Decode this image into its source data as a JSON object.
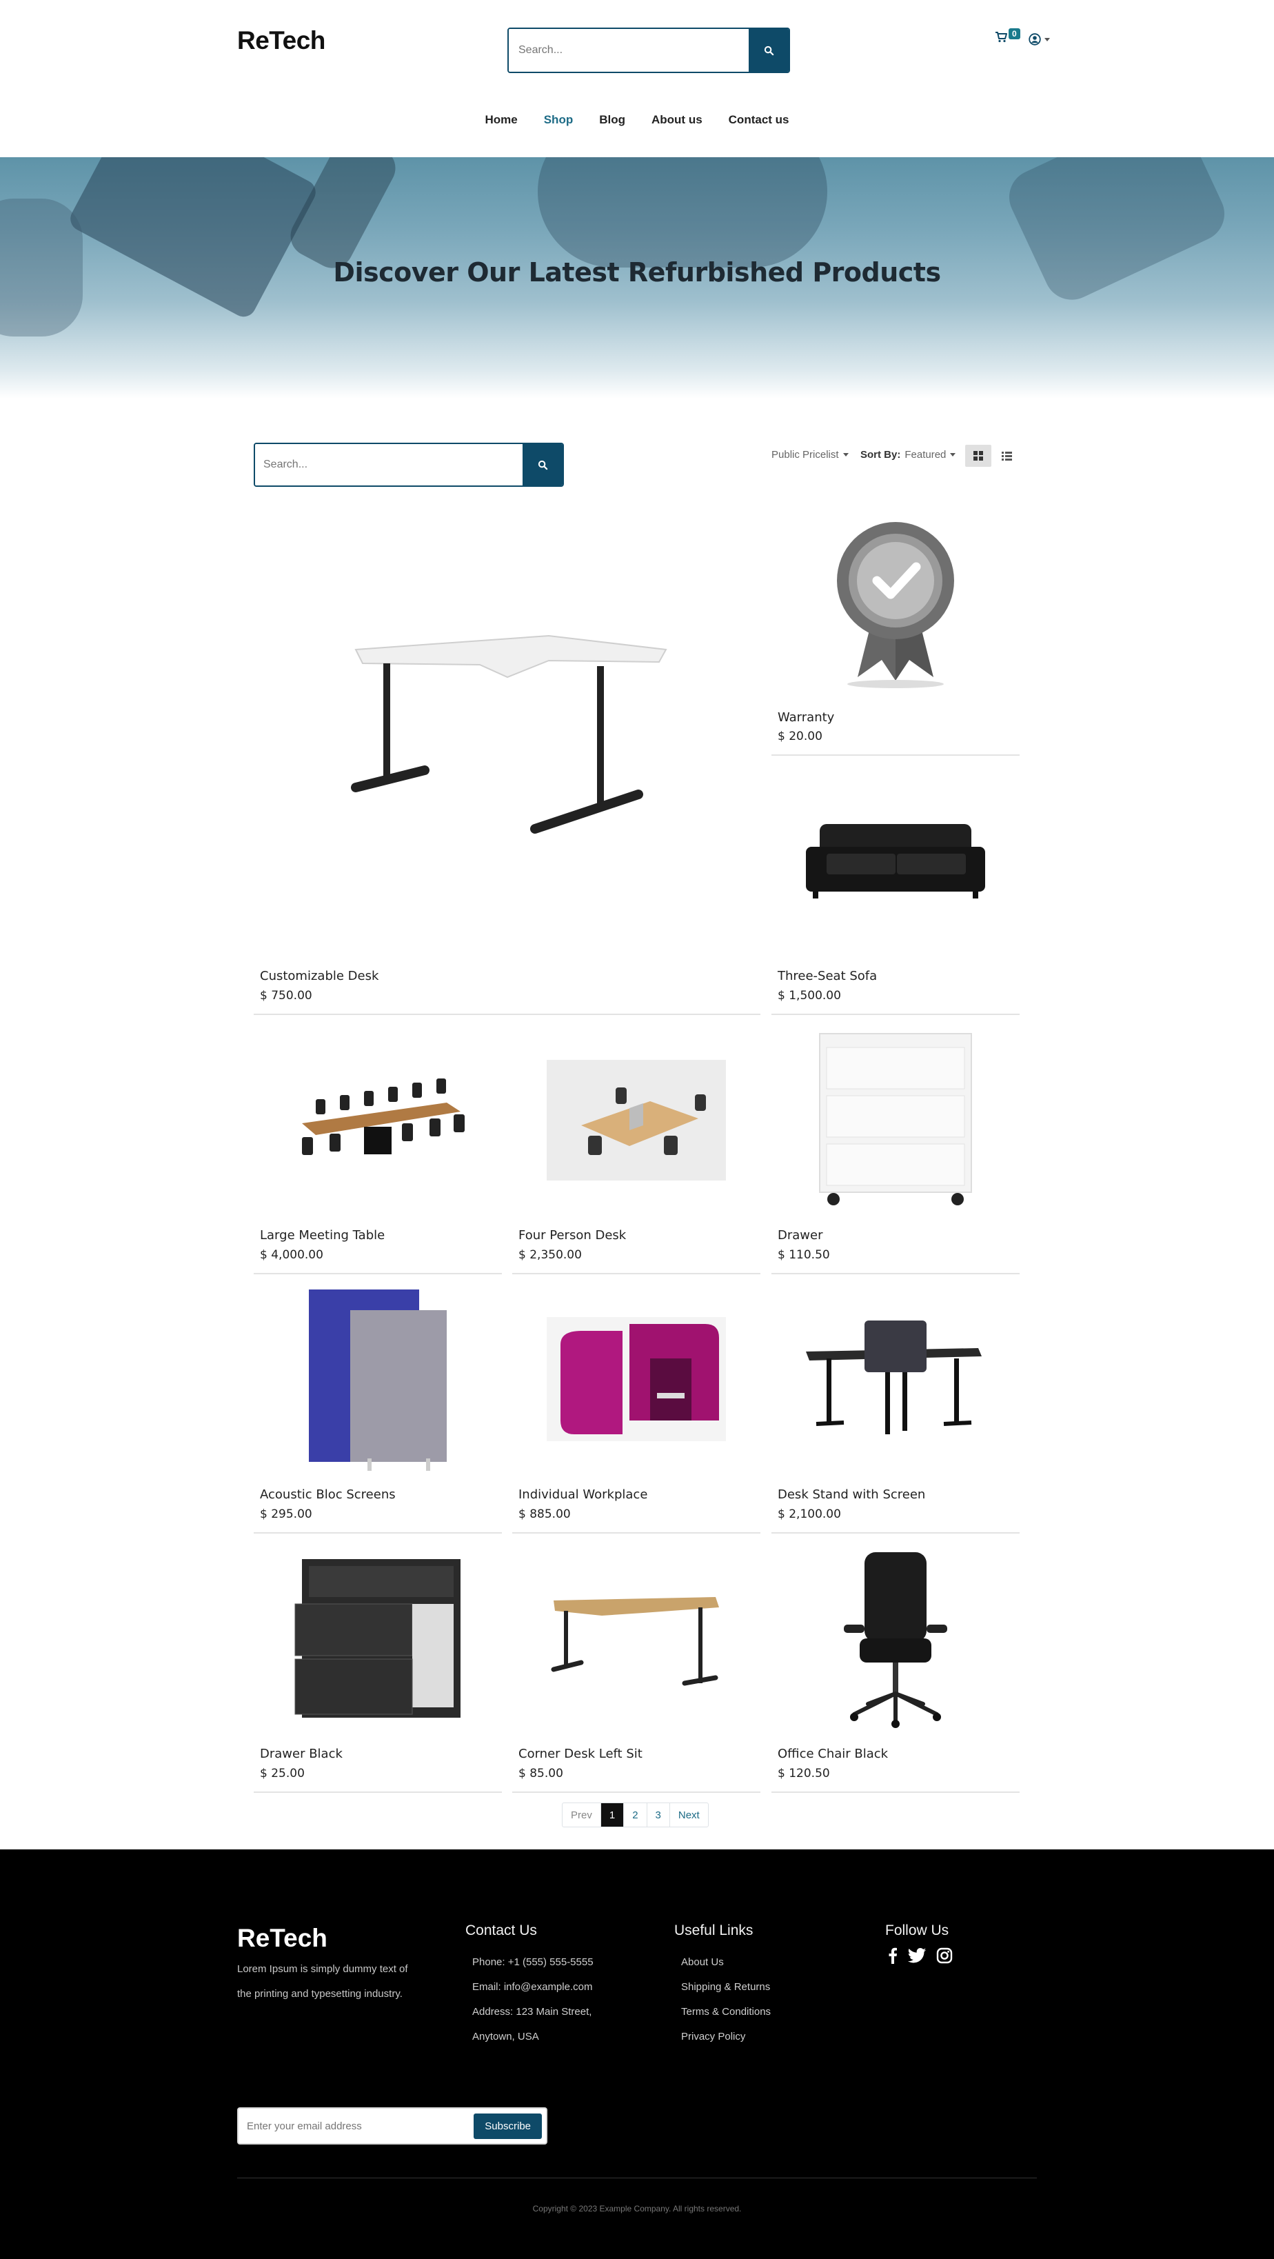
{
  "brand": {
    "name": "ReTech"
  },
  "header": {
    "search_placeholder": "Search...",
    "cart_count": "0"
  },
  "nav": [
    {
      "label": "Home",
      "active": false
    },
    {
      "label": "Shop",
      "active": true
    },
    {
      "label": "Blog",
      "active": false
    },
    {
      "label": "About us",
      "active": false
    },
    {
      "label": "Contact us",
      "active": false
    }
  ],
  "hero": {
    "title": "Discover Our Latest Refurbished Products"
  },
  "toolbar": {
    "search_placeholder": "Search...",
    "pricelist": "Public Pricelist",
    "sort_label": "Sort By:",
    "sort_value": "Featured"
  },
  "products": [
    {
      "name": "Customizable Desk",
      "price": "$ 750.00",
      "image": "desk-image"
    },
    {
      "name": "Warranty",
      "price": "$ 20.00",
      "image": "warranty-badge-image"
    },
    {
      "name": "Three-Seat Sofa",
      "price": "$ 1,500.00",
      "image": "sofa-image"
    },
    {
      "name": "Large Meeting Table",
      "price": "$ 4,000.00",
      "image": "meeting-table-image"
    },
    {
      "name": "Four Person Desk",
      "price": "$ 2,350.00",
      "image": "four-person-desk-image"
    },
    {
      "name": "Drawer",
      "price": "$ 110.50",
      "image": "drawer-image"
    },
    {
      "name": "Acoustic Bloc Screens",
      "price": "$ 295.00",
      "image": "acoustic-screens-image"
    },
    {
      "name": "Individual Workplace",
      "price": "$ 885.00",
      "image": "individual-workplace-image"
    },
    {
      "name": "Desk Stand with Screen",
      "price": "$ 2,100.00",
      "image": "desk-stand-image"
    },
    {
      "name": "Drawer Black",
      "price": "$ 25.00",
      "image": "drawer-black-image"
    },
    {
      "name": "Corner Desk Left Sit",
      "price": "$ 85.00",
      "image": "corner-desk-image"
    },
    {
      "name": "Office Chair Black",
      "price": "$ 120.50",
      "image": "office-chair-image"
    }
  ],
  "pager": {
    "prev": "Prev",
    "pages": [
      "1",
      "2",
      "3"
    ],
    "current": "1",
    "next": "Next"
  },
  "footer": {
    "brand": "ReTech",
    "about": "Lorem Ipsum is simply dummy text of the printing and typesetting industry.",
    "contact_heading": "Contact Us",
    "contact": [
      "Phone: +1 (555) 555-5555",
      "Email: info@example.com",
      "Address: 123 Main Street,",
      "Anytown, USA"
    ],
    "links_heading": "Useful Links",
    "links": [
      "About Us",
      "Shipping & Returns",
      "Terms & Conditions",
      "Privacy Policy"
    ],
    "follow_heading": "Follow Us",
    "social": [
      "facebook-icon",
      "twitter-icon",
      "instagram-icon"
    ],
    "newsletter_placeholder": "Enter your email address",
    "subscribe": "Subscribe",
    "copyright": "Copyright © 2023 Example Company. All rights reserved."
  },
  "colors": {
    "primary": "#0e4a68",
    "accent": "#1d6b86",
    "footer_bg": "#000000"
  }
}
